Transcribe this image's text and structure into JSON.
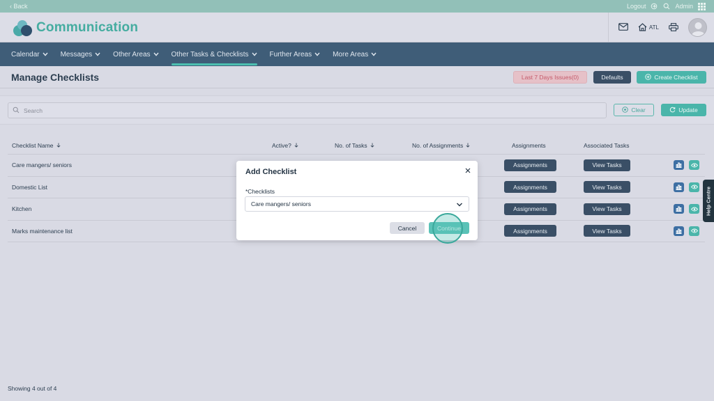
{
  "topstrip": {
    "back": "‹ Back",
    "logout": "Logout",
    "admin": "Admin"
  },
  "header": {
    "app_title": "Communication",
    "home_label": "ATL"
  },
  "nav": {
    "items": [
      {
        "label": "Calendar"
      },
      {
        "label": "Messages"
      },
      {
        "label": "Other Areas"
      },
      {
        "label": "Other Tasks & Checklists"
      },
      {
        "label": "Further Areas"
      },
      {
        "label": "More Areas"
      }
    ]
  },
  "page": {
    "title": "Manage Checklists",
    "issues_button": "Last 7 Days Issues(0)",
    "defaults_button": "Defaults",
    "create_button": "Create Checklist"
  },
  "search": {
    "placeholder": "Search",
    "clear": "Clear",
    "update": "Update"
  },
  "table": {
    "headers": {
      "name": "Checklist Name",
      "active": "Active?",
      "tasks": "No. of Tasks",
      "assignments_count": "No. of Assignments",
      "assignments": "Assignments",
      "associated": "Associated Tasks"
    },
    "rows": [
      {
        "name": "Care mangers/ seniors",
        "assign_btn": "Assignments",
        "view_btn": "View Tasks"
      },
      {
        "name": "Domestic List",
        "assign_btn": "Assignments",
        "view_btn": "View Tasks"
      },
      {
        "name": "Kitchen",
        "assign_btn": "Assignments",
        "view_btn": "View Tasks"
      },
      {
        "name": "Marks maintenance list",
        "assign_btn": "Assignments",
        "view_btn": "View Tasks"
      }
    ]
  },
  "footer": {
    "showing": "Showing 4 out of 4"
  },
  "help": {
    "label": "Help Centre"
  },
  "modal": {
    "title": "Add Checklist",
    "field_label": "*Checklists",
    "selected": "Care mangers/ seniors",
    "cancel": "Cancel",
    "continue": "Continue"
  },
  "colors": {
    "brand_teal": "#45aca0",
    "nav_bg": "#3f5d78",
    "dark_button": "#3a4f66",
    "issues_red": "#c55a6a"
  }
}
